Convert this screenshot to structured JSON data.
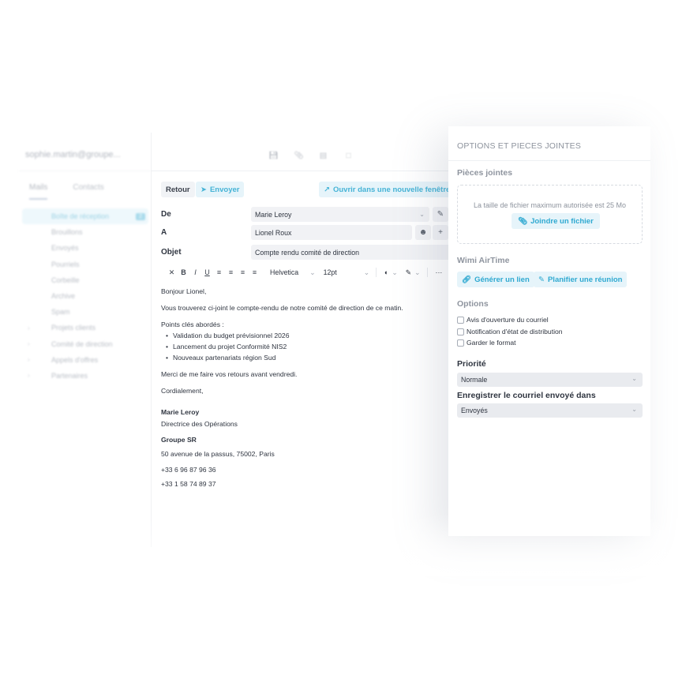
{
  "sidebar": {
    "account": "sophie.martin@groupe...",
    "tabs": [
      "Mails",
      "Contacts"
    ],
    "folders": [
      {
        "label": "Boîte de réception",
        "count": "2",
        "active": true
      },
      {
        "label": "Brouillons"
      },
      {
        "label": "Envoyés"
      },
      {
        "label": "Pourriels"
      },
      {
        "label": "Corbeille"
      },
      {
        "label": "Archive"
      },
      {
        "label": "Spam"
      },
      {
        "label": "Projets clients",
        "chevron": true
      },
      {
        "label": "Comité de direction",
        "chevron": true
      },
      {
        "label": "Appels d'offres",
        "chevron": true
      },
      {
        "label": "Partenaires",
        "chevron": true
      }
    ]
  },
  "toolbar": {
    "icons": [
      "save-icon",
      "paperclip-icon",
      "signature-icon",
      "chat-icon"
    ]
  },
  "compose": {
    "retour_label": "Retour",
    "send_label": "Envoyer",
    "open_window_label": "Ouvrir dans une nouvelle fenêtre",
    "from_label": "De",
    "from_value": "Marie Leroy",
    "to_label": "A",
    "to_value": "Lionel Roux",
    "subject_label": "Objet",
    "subject_value": "Compte rendu comité de direction",
    "format": {
      "font": "Helvetica",
      "size": "12pt"
    },
    "body": {
      "greeting": "Bonjour Lionel,",
      "intro": "Vous trouverez ci-joint le compte-rendu de notre comité de direction de ce matin.",
      "points_title": "Points clés abordés :",
      "points": [
        "Validation du budget prévisionnel 2026",
        "Lancement du projet Conformité NIS2",
        "Nouveaux partenariats région Sud"
      ],
      "request": "Merci de me faire vos retours avant vendredi.",
      "closing": "Cordialement,",
      "signature": {
        "name": "Marie Leroy",
        "role": "Directrice des Opérations",
        "company": "Groupe SR",
        "address": "50 avenue de la passus, 75002, Paris",
        "phone1": "+33 6 96 87 96 36",
        "phone2": "+33 1 58 74 89 37"
      }
    }
  },
  "panel": {
    "title": "OPTIONS ET PIECES JOINTES",
    "attachments_title": "Pièces jointes",
    "max_size_hint": "La taille de fichier maximum autorisée est 25 Mo",
    "attach_label": "Joindre un fichier",
    "airtime_title": "Wimi AirTime",
    "generate_link_label": "Générer un lien",
    "plan_meeting_label": "Planifier une réunion",
    "options_title": "Options",
    "options": [
      {
        "label": "Avis d'ouverture du courriel",
        "checked": false
      },
      {
        "label": "Notification d'état de distribution",
        "checked": false
      },
      {
        "label": "Garder le format",
        "checked": false
      }
    ],
    "priority_title": "Priorité",
    "priority_value": "Normale",
    "save_in_title": "Enregistrer le courriel envoyé dans",
    "save_in_value": "Envoyés"
  },
  "colors": {
    "accent": "#2fa9d1",
    "accent_bg": "#e6f4fa"
  }
}
